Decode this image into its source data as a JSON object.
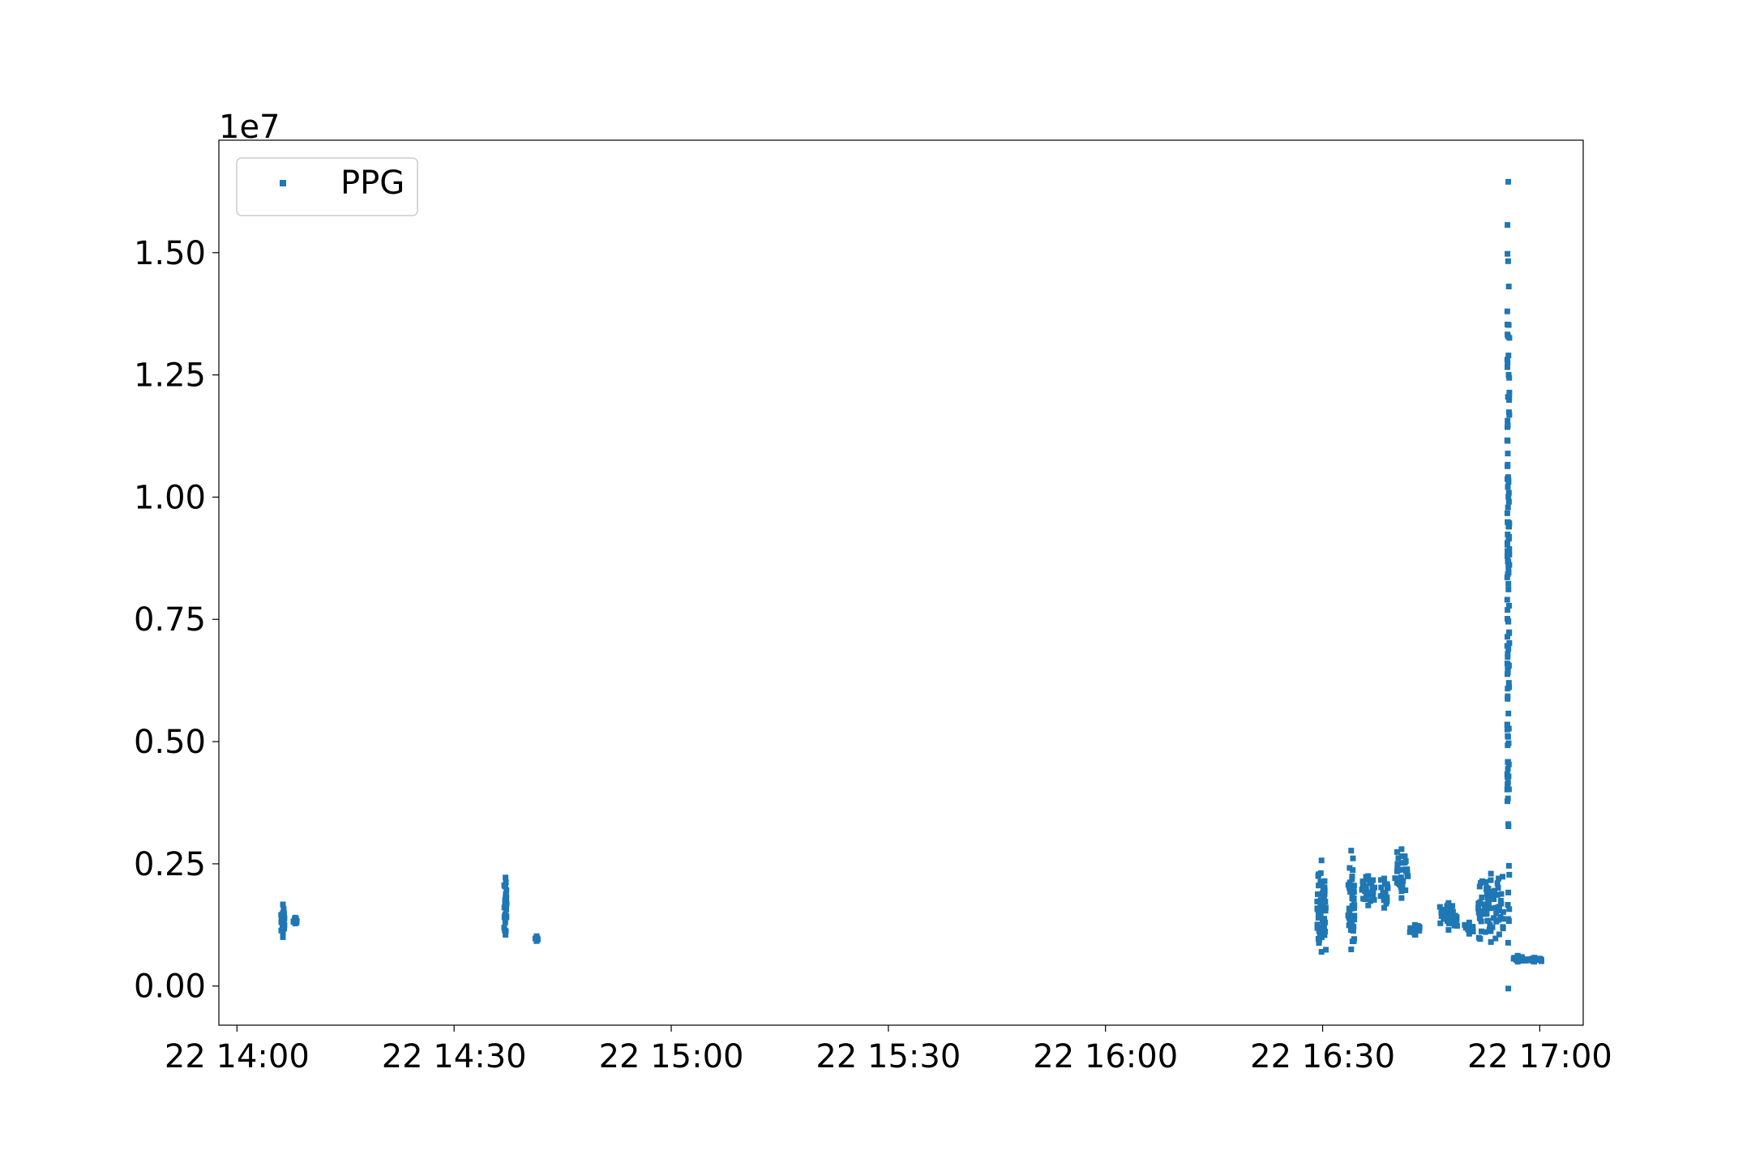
{
  "chart_data": {
    "type": "scatter",
    "title": "",
    "xlabel": "",
    "ylabel": "",
    "y_offset_label": "1e7",
    "x_tick_labels": [
      "22 14:00",
      "22 14:30",
      "22 15:00",
      "22 15:30",
      "22 16:00",
      "22 16:30",
      "22 17:00"
    ],
    "x_tick_minutes": [
      0,
      30,
      60,
      90,
      120,
      150,
      180
    ],
    "xlim_minutes": [
      -2.5,
      186
    ],
    "x_origin_label": "22 14:00",
    "y_tick_labels": [
      "0.00",
      "0.25",
      "0.50",
      "0.75",
      "1.00",
      "1.25",
      "1.50"
    ],
    "y_ticks": [
      0.0,
      0.25,
      0.5,
      0.75,
      1.0,
      1.25,
      1.5
    ],
    "ylim": [
      -0.08,
      1.73
    ],
    "legend": {
      "label": "PPG",
      "position": "upper left"
    },
    "grid": false,
    "series_color": "#1f77b4",
    "series": [
      {
        "name": "PPG",
        "clusters": [
          {
            "x_start": 6.1,
            "x_end": 6.6,
            "y_min": 0.1,
            "y_max": 0.167,
            "count": 24
          },
          {
            "x_start": 7.8,
            "x_end": 8.3,
            "y_min": 0.128,
            "y_max": 0.14,
            "count": 6
          },
          {
            "x_start": 36.9,
            "x_end": 37.3,
            "y_min": 0.105,
            "y_max": 0.222,
            "count": 28
          },
          {
            "x_start": 41.2,
            "x_end": 41.6,
            "y_min": 0.092,
            "y_max": 0.102,
            "count": 4
          },
          {
            "x_start": 149.2,
            "x_end": 150.5,
            "y_min": 0.07,
            "y_max": 0.257,
            "count": 60
          },
          {
            "x_start": 153.5,
            "x_end": 154.4,
            "y_min": 0.075,
            "y_max": 0.277,
            "count": 50
          },
          {
            "x_start": 155.4,
            "x_end": 157.2,
            "y_min": 0.165,
            "y_max": 0.225,
            "count": 30
          },
          {
            "x_start": 158.0,
            "x_end": 159.0,
            "y_min": 0.16,
            "y_max": 0.22,
            "count": 20
          },
          {
            "x_start": 160.0,
            "x_end": 161.8,
            "y_min": 0.18,
            "y_max": 0.28,
            "count": 30
          },
          {
            "x_start": 162.0,
            "x_end": 163.5,
            "y_min": 0.105,
            "y_max": 0.125,
            "count": 12
          },
          {
            "x_start": 166.2,
            "x_end": 168.6,
            "y_min": 0.115,
            "y_max": 0.17,
            "count": 40
          },
          {
            "x_start": 169.6,
            "x_end": 170.9,
            "y_min": 0.107,
            "y_max": 0.13,
            "count": 14
          },
          {
            "x_start": 171.5,
            "x_end": 175.0,
            "y_min": 0.09,
            "y_max": 0.23,
            "count": 70
          },
          {
            "x_start": 175.5,
            "x_end": 175.8,
            "y_min": -0.005,
            "y_max": 1.645,
            "count": 130
          },
          {
            "x_start": 176.3,
            "x_end": 177.6,
            "y_min": 0.05,
            "y_max": 0.062,
            "count": 14
          },
          {
            "x_start": 178.0,
            "x_end": 180.5,
            "y_min": 0.05,
            "y_max": 0.058,
            "count": 18
          }
        ]
      }
    ]
  }
}
